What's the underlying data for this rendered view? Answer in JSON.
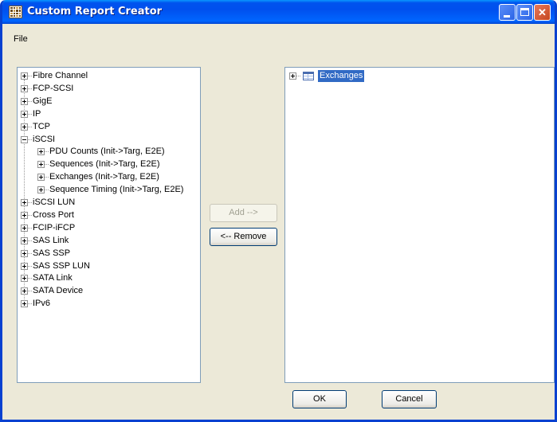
{
  "window": {
    "title": "Custom Report Creator",
    "controls": {
      "minimize": "_",
      "maximize": "□",
      "close": "✕"
    }
  },
  "menu": {
    "file": "File"
  },
  "available_tree": {
    "items": [
      {
        "label": "Fibre Channel",
        "expanded": false
      },
      {
        "label": "FCP-SCSI",
        "expanded": false
      },
      {
        "label": "GigE",
        "expanded": false
      },
      {
        "label": "IP",
        "expanded": false
      },
      {
        "label": "TCP",
        "expanded": false
      },
      {
        "label": "iSCSI",
        "expanded": true,
        "children": [
          {
            "label": "PDU Counts (Init->Targ, E2E)"
          },
          {
            "label": "Sequences (Init->Targ, E2E)"
          },
          {
            "label": "Exchanges (Init->Targ, E2E)"
          },
          {
            "label": "Sequence Timing (Init->Targ, E2E)"
          }
        ]
      },
      {
        "label": "iSCSI LUN",
        "expanded": false
      },
      {
        "label": "Cross Port",
        "expanded": false
      },
      {
        "label": "FCIP-iFCP",
        "expanded": false
      },
      {
        "label": "SAS Link",
        "expanded": false
      },
      {
        "label": "SAS SSP",
        "expanded": false
      },
      {
        "label": "SAS SSP LUN",
        "expanded": false
      },
      {
        "label": "SATA Link",
        "expanded": false
      },
      {
        "label": "SATA Device",
        "expanded": false
      },
      {
        "label": "IPv6",
        "expanded": false
      }
    ]
  },
  "selected_tree": {
    "items": [
      {
        "label": "Exchanges",
        "selected": true,
        "icon": "table-icon"
      }
    ]
  },
  "buttons": {
    "add": "Add -->",
    "remove": "<-- Remove",
    "ok": "OK",
    "cancel": "Cancel"
  },
  "colors": {
    "title_blue": "#0053ee",
    "selection": "#316ac5",
    "window_bg": "#ece9d8"
  }
}
